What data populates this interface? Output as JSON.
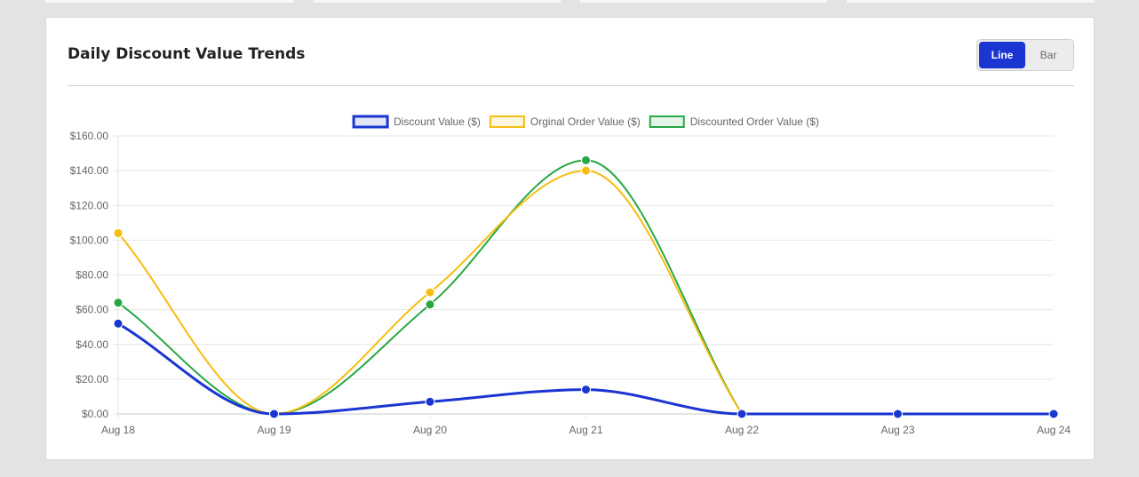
{
  "card": {
    "title": "Daily Discount Value Trends"
  },
  "toggle": {
    "line_label": "Line",
    "bar_label": "Bar",
    "active": "Line"
  },
  "colors": {
    "accent": "#1a35d1"
  },
  "chart_data": {
    "type": "line",
    "categories": [
      "Aug 18",
      "Aug 19",
      "Aug 20",
      "Aug 21",
      "Aug 22",
      "Aug 23",
      "Aug 24"
    ],
    "series": [
      {
        "name": "Discount Value ($)",
        "color": "#1a35d1",
        "fill": "#e3e6f7",
        "values": [
          52,
          0,
          7,
          14,
          0,
          0,
          0
        ]
      },
      {
        "name": "Orginal Order Value ($)",
        "color": "#f5bd12",
        "fill": "#fef6dc",
        "values": [
          104,
          0,
          70,
          140,
          0,
          null,
          null
        ]
      },
      {
        "name": "Discounted Order Value ($)",
        "color": "#28a745",
        "fill": "#e4f4e8",
        "values": [
          64,
          0,
          63,
          146,
          0,
          null,
          null
        ]
      }
    ],
    "y_ticks": [
      "$0.00",
      "$20.00",
      "$40.00",
      "$60.00",
      "$80.00",
      "$100.00",
      "$120.00",
      "$140.00",
      "$160.00"
    ],
    "ylim": [
      0,
      160
    ],
    "grid": true,
    "legend_position": "top-center"
  }
}
